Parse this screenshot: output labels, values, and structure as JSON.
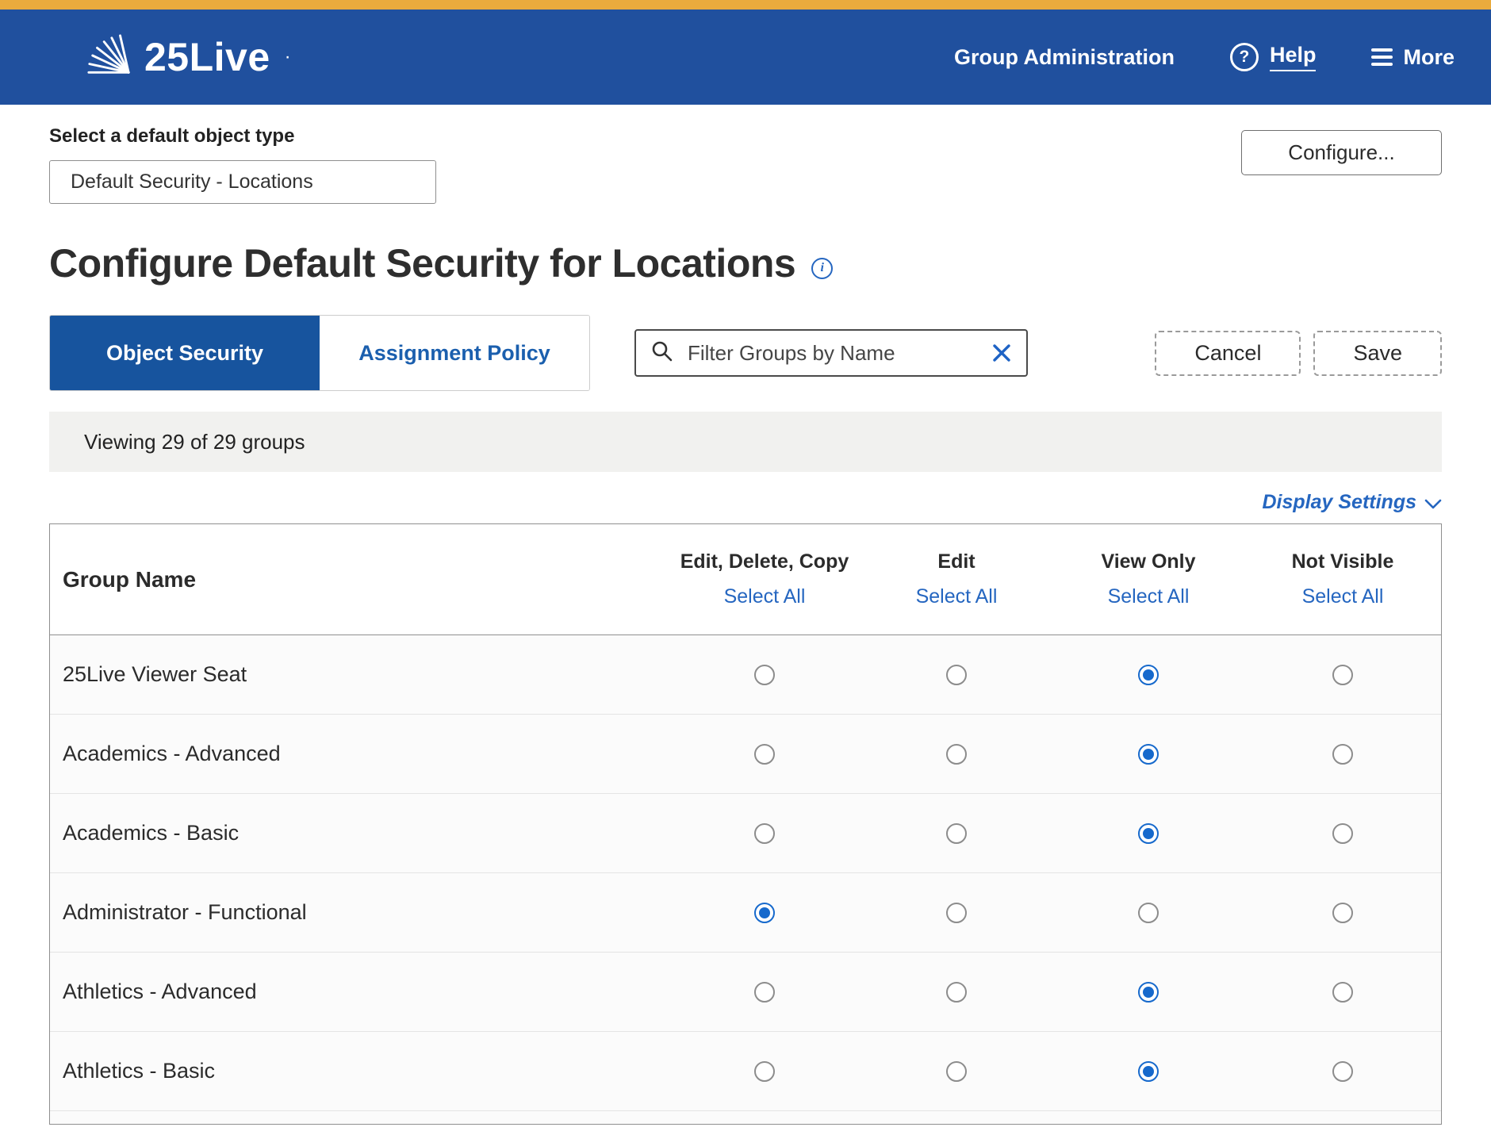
{
  "header": {
    "brand": "25Live",
    "nav_group_administration": "Group Administration",
    "help_label": "Help",
    "more_label": "More"
  },
  "object_type": {
    "label": "Select a default object type",
    "value": "Default Security - Locations",
    "configure_button": "Configure..."
  },
  "page": {
    "title": "Configure Default Security for Locations"
  },
  "tabs": [
    {
      "label": "Object Security",
      "active": true
    },
    {
      "label": "Assignment Policy",
      "active": false
    }
  ],
  "filter": {
    "placeholder": "Filter Groups by Name"
  },
  "actions": {
    "cancel": "Cancel",
    "save": "Save"
  },
  "status": {
    "viewing": "Viewing 29 of 29 groups"
  },
  "display_settings": {
    "label": "Display Settings"
  },
  "table": {
    "group_name_header": "Group Name",
    "select_all_label": "Select All",
    "columns": [
      "Edit, Delete, Copy",
      "Edit",
      "View Only",
      "Not Visible"
    ],
    "rows": [
      {
        "name": "25Live Viewer Seat",
        "selected": 2
      },
      {
        "name": "Academics - Advanced",
        "selected": 2
      },
      {
        "name": "Academics - Basic",
        "selected": 2
      },
      {
        "name": "Administrator - Functional",
        "selected": 0
      },
      {
        "name": "Athletics - Advanced",
        "selected": 2
      },
      {
        "name": "Athletics - Basic",
        "selected": 2
      }
    ]
  },
  "colors": {
    "brand_blue": "#20509E",
    "accent_gold": "#EAAB3D",
    "tab_active_blue": "#17549E",
    "link_blue": "#2566C0",
    "radio_blue": "#1669CC"
  }
}
